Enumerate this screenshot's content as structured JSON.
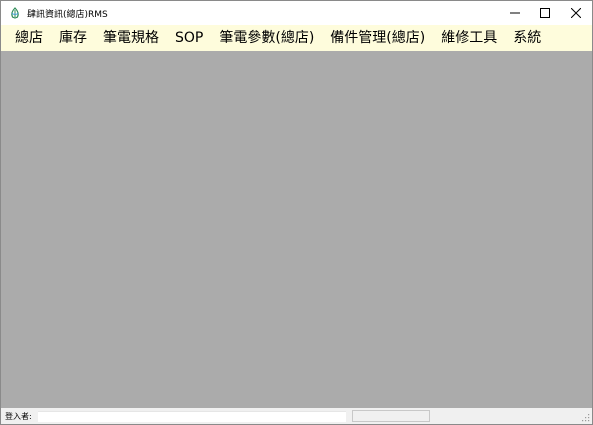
{
  "window": {
    "title": "肆訊資訊(總店)RMS",
    "controls": {
      "minimize_icon": "minimize-icon",
      "maximize_icon": "maximize-icon",
      "close_icon": "close-icon"
    }
  },
  "menu": {
    "items": [
      {
        "label": "總店"
      },
      {
        "label": "庫存"
      },
      {
        "label": "筆電規格"
      },
      {
        "label": "SOP"
      },
      {
        "label": "筆電參數(總店)"
      },
      {
        "label": "備件管理(總店)"
      },
      {
        "label": "維修工具"
      },
      {
        "label": "系統"
      }
    ]
  },
  "status": {
    "login_label": "登入者:",
    "login_value": "",
    "secondary_value": ""
  },
  "colors": {
    "menubar_bg": "#fefcdc",
    "client_bg": "#ababab",
    "titlebar_bg": "#ffffff",
    "app_icon": "#2e8b57"
  }
}
